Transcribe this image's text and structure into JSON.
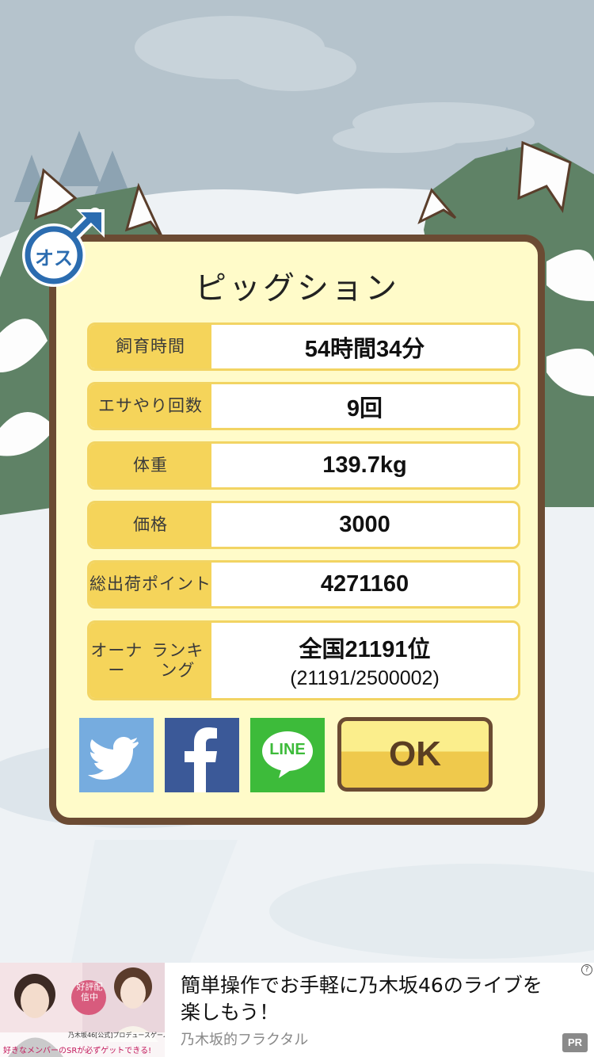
{
  "pig": {
    "name": "ピッグション",
    "gender_badge": "オス",
    "gender_icon": "male-symbol-icon"
  },
  "stats": [
    {
      "label": "飼育時間",
      "value": "54時間34分"
    },
    {
      "label": "エサやり回数",
      "value": "9回"
    },
    {
      "label": "体重",
      "value": "139.7kg"
    },
    {
      "label": "価格",
      "value": "3000"
    },
    {
      "label": "総出荷ポイント",
      "value": "4271160"
    }
  ],
  "labels": {
    "shipping_line1": "総出荷",
    "shipping_line2": "ポイント",
    "ranking_line1": "オーナー",
    "ranking_line2": "ランキング"
  },
  "ranking": {
    "label": "オーナーランキング",
    "value": "全国21191位",
    "detail": "(21191/2500002)"
  },
  "share": {
    "twitter_icon": "twitter-bird-icon",
    "facebook_icon": "facebook-f-icon",
    "line_label": "LINE"
  },
  "ok_label": "OK",
  "ad": {
    "headline": "簡単操作でお手軽に乃木坂46のライブを楽しもう！",
    "sponsor": "乃木坂的フラクタル",
    "info_label": "?",
    "pr_label": "PR",
    "image_badge": "好評配信中",
    "image_caption1": "乃木坂46[公式]プロデュースゲーム",
    "image_caption2": "好きなメンバーのSRが必ずゲットできる!"
  },
  "colors": {
    "frame": "#6b4b33",
    "panel": "#fffbc9",
    "label_bg": "#f5d45a",
    "twitter": "#76acdf",
    "facebook": "#3b5998",
    "line": "#3dbb3a"
  }
}
